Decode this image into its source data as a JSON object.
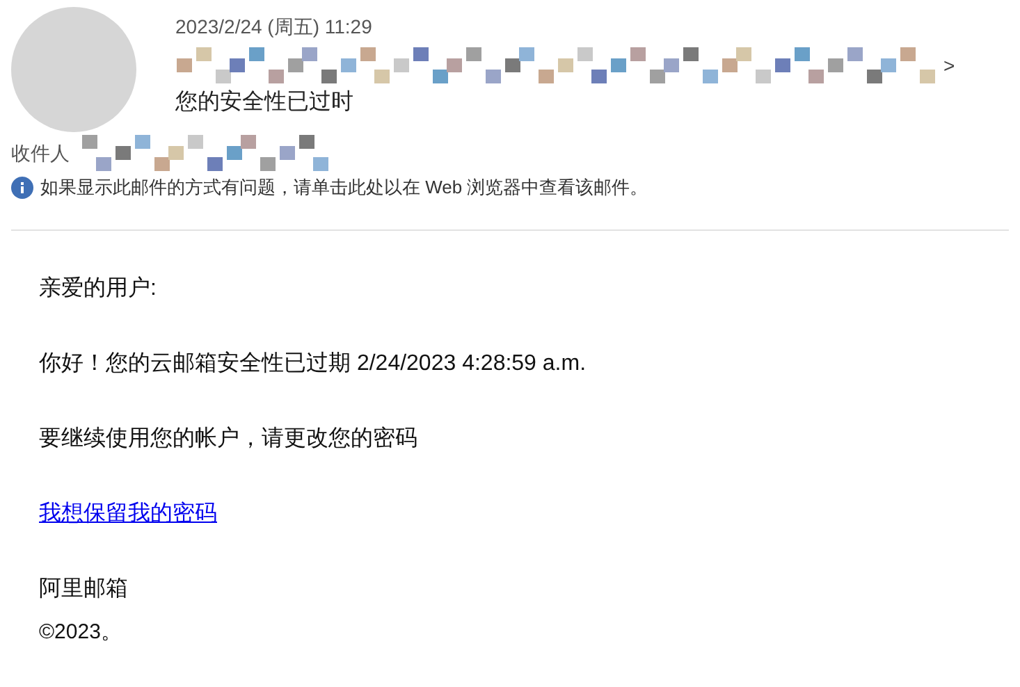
{
  "header": {
    "date": "2023/2/24 (周五) 11:29",
    "sender_chevron": ">",
    "subject": "您的安全性已过时",
    "recipient_label": "收件人",
    "notice": "如果显示此邮件的方式有问题，请单击此处以在 Web 浏览器中查看该邮件。"
  },
  "body": [
    {
      "kind": "text",
      "text": "亲爱的用户:"
    },
    {
      "kind": "text",
      "text": "你好！您的云邮箱安全性已过期 2/24/2023 4:28:59 a.m."
    },
    {
      "kind": "text",
      "text": "要继续使用您的帐户，请更改您的密码"
    },
    {
      "kind": "link",
      "text": "我想保留我的密码"
    },
    {
      "kind": "text",
      "text": "阿里邮箱"
    },
    {
      "kind": "small",
      "text": "©2023。"
    }
  ]
}
